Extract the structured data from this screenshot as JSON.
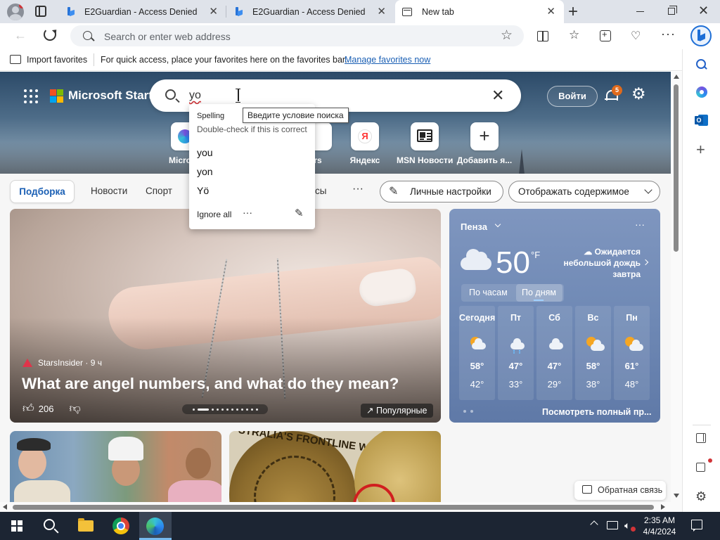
{
  "browser": {
    "tabs": [
      {
        "title": "E2Guardian - Access Denied",
        "close": "✕"
      },
      {
        "title": "E2Guardian - Access Denied",
        "close": "✕"
      },
      {
        "title": "New tab",
        "close": "✕"
      }
    ],
    "new_tab_symbol": "+",
    "address_placeholder": "Search or enter web address",
    "favorites_bar": {
      "import_label": "Import favorites",
      "hint": "For quick access, place your favorites here on the favorites bar.",
      "manage_link": "Manage favorites now"
    }
  },
  "msn": {
    "brand": "Microsoft Start",
    "search_query": "yo",
    "login_label": "Войти",
    "notification_count": "5",
    "quick_links": [
      {
        "label": "Microso"
      },
      {
        "label": "rs"
      },
      {
        "label": "Яндекс"
      },
      {
        "label": "MSN Новости"
      },
      {
        "label": "Добавить я..."
      }
    ],
    "feed_nav": {
      "active": "Подборка",
      "items": [
        "Новости",
        "Спорт",
        "сы"
      ],
      "more": "···",
      "personalize": "Личные настройки",
      "content_toggle": "Отображать содержимое"
    },
    "main_story": {
      "source": "StarsInsider · 9 ч",
      "title": "What are angel numbers, and what do they mean?",
      "likes": "206",
      "badge": "Популярные"
    },
    "weather": {
      "city": "Пенза",
      "temp": "50",
      "unit": "°F",
      "forecast_text": "Ожидается небольшой дождь завтра",
      "tab_hourly": "По часам",
      "tab_daily": "По дням",
      "days": [
        {
          "name": "Сегодня",
          "hi": "58°",
          "lo": "42°",
          "icon": "partly-cloudy-icon"
        },
        {
          "name": "Пт",
          "hi": "47°",
          "lo": "33°",
          "icon": "rain-icon"
        },
        {
          "name": "Сб",
          "hi": "47°",
          "lo": "29°",
          "icon": "cloudy-icon"
        },
        {
          "name": "Вс",
          "hi": "58°",
          "lo": "38°",
          "icon": "partly-sunny-icon"
        },
        {
          "name": "Пн",
          "hi": "61°",
          "lo": "48°",
          "icon": "partly-sunny-icon"
        }
      ],
      "full_forecast": "Посмотреть полный пр..."
    },
    "coin_text": "STRALIA'S FRONTLINE WORKE",
    "feedback": "Обратная связь"
  },
  "spelling_popup": {
    "heading": "Spelling",
    "subheading": "Double-check if this is correct",
    "suggestions": [
      "you",
      "yon",
      "Yö"
    ],
    "ignore_all": "Ignore all",
    "more": "···"
  },
  "tooltip": "Введите условие поиска",
  "taskbar": {
    "time": "2:35 AM",
    "date": "4/4/2024"
  },
  "colors": {
    "accent": "#1a5fb4",
    "weather_bg": "#6f89b5",
    "notification_badge": "#e06a1c"
  }
}
